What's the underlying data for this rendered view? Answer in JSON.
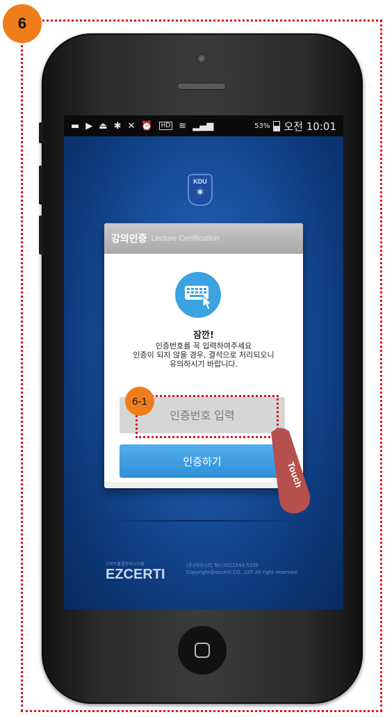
{
  "step_badge": "6",
  "sub_step_badge": "6-1",
  "touch_label": "Touch",
  "statusbar": {
    "battery": "53%",
    "time": "오전 10:01"
  },
  "logo": {
    "text": "KDU"
  },
  "dialog": {
    "title": "강의인증",
    "subtitle": "Lecture Certification",
    "notice_title": "잠깐!",
    "notice_lines": [
      "인증번호를 꼭 입력하여주세요",
      "인증이 되지 않을 경우, 결석으로 처리되오니",
      "유의하시기 바랍니다."
    ],
    "input_placeholder": "인증번호 입력",
    "submit_label": "인증하기"
  },
  "footer": {
    "brand": "EZCERTI",
    "tagline": "스마트출결관리시스템",
    "contact": "(주)아이시티 Tel:(02)1544-5105",
    "copyright": "Copyright@ezcerti.CO., LST All right reserved."
  },
  "colors": {
    "annotation_red": "#d8121a",
    "badge_orange": "#f07d1c",
    "button_blue": "#3a9ae0",
    "touch_tag": "#b5504c"
  }
}
